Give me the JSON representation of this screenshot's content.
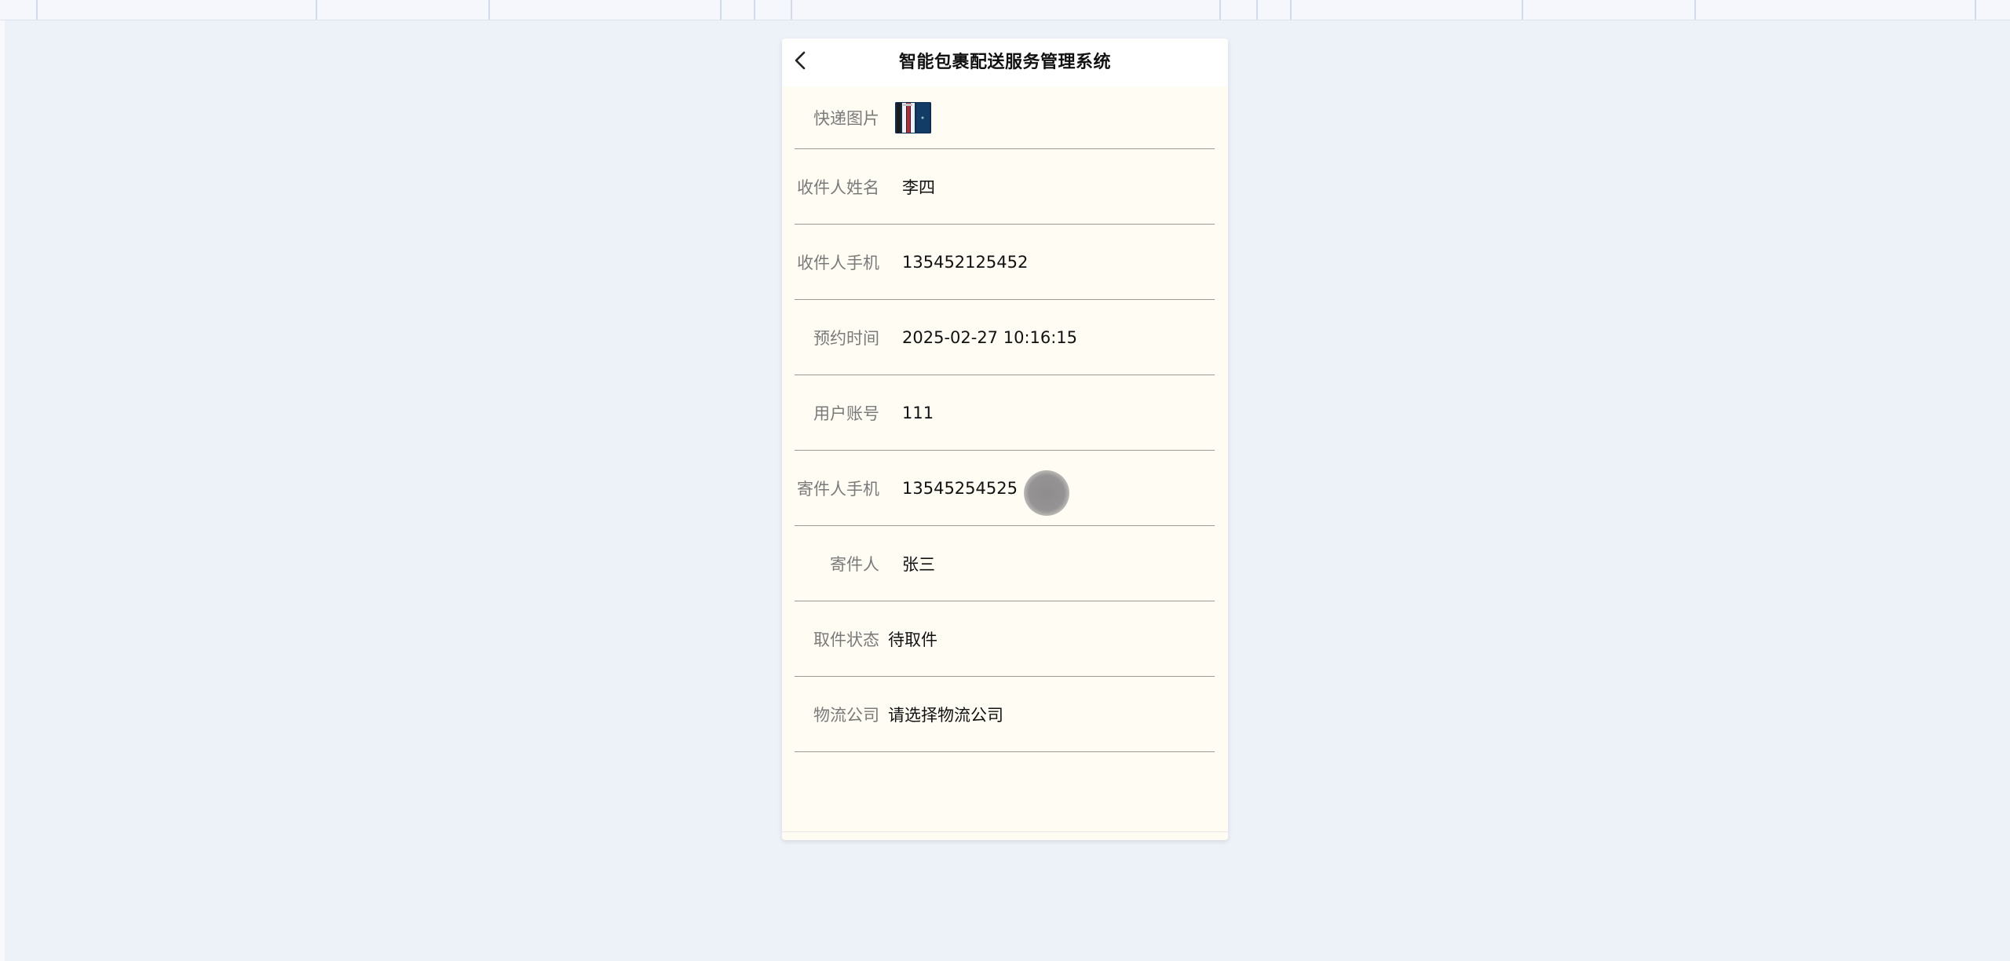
{
  "header": {
    "title": "智能包裹配送服务管理系统",
    "back_icon": "chevron-left-icon"
  },
  "form": {
    "fields": [
      {
        "label": "快递图片",
        "value": "",
        "type": "image"
      },
      {
        "label": "收件人姓名",
        "value": "李四"
      },
      {
        "label": "收件人手机",
        "value": "135452125452"
      },
      {
        "label": "预约时间",
        "value": "2025-02-27 10:16:15"
      },
      {
        "label": "用户账号",
        "value": "111"
      },
      {
        "label": "寄件人手机",
        "value": "13545254525"
      },
      {
        "label": "寄件人",
        "value": "张三"
      },
      {
        "label": "取件状态",
        "value": "待取件"
      },
      {
        "label": "物流公司",
        "value": "请选择物流公司"
      }
    ]
  },
  "colors": {
    "page_background": "#edf1f8",
    "card_background": "#fffcf3",
    "header_background": "#ffffff",
    "label_color": "#7a7a7a",
    "value_color": "#111111",
    "divider_color": "#9a9a9a"
  }
}
